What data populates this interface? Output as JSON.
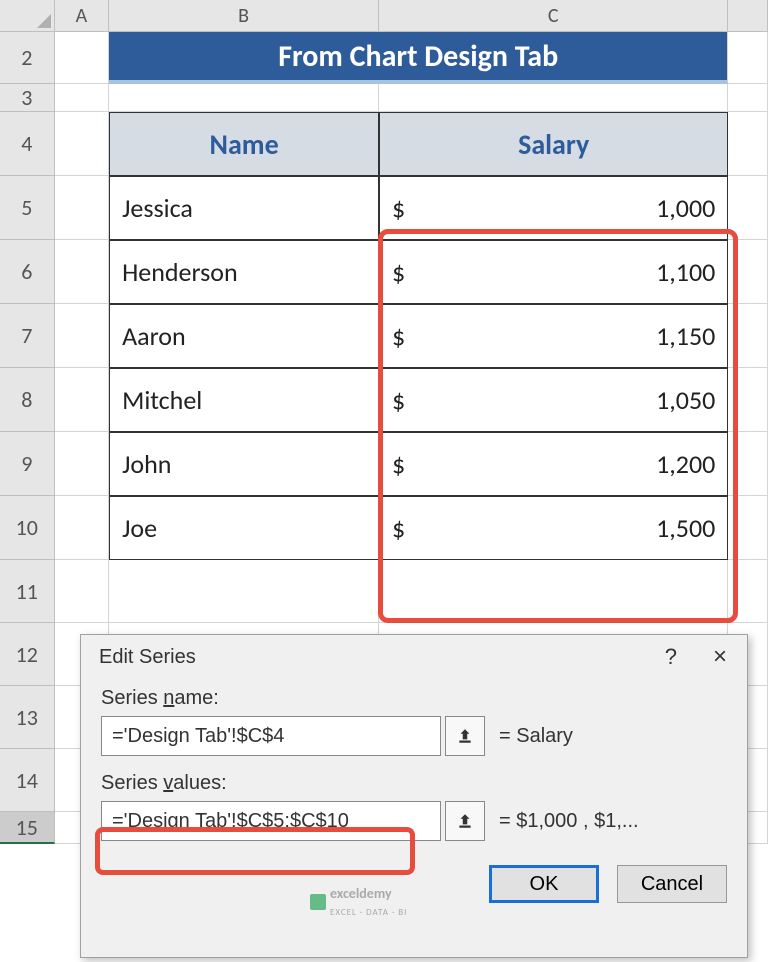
{
  "col_headers": {
    "A": "A",
    "B": "B",
    "C": "C"
  },
  "row_headers": [
    "2",
    "3",
    "4",
    "5",
    "6",
    "7",
    "8",
    "9",
    "10",
    "11",
    "12",
    "13",
    "14",
    "15"
  ],
  "title": "From Chart Design Tab",
  "table": {
    "head_name": "Name",
    "head_salary": "Salary",
    "rows": [
      {
        "name": "Jessica",
        "sym": "$",
        "val": "1,000"
      },
      {
        "name": "Henderson",
        "sym": "$",
        "val": "1,100"
      },
      {
        "name": "Aaron",
        "sym": "$",
        "val": "1,150"
      },
      {
        "name": "Mitchel",
        "sym": "$",
        "val": "1,050"
      },
      {
        "name": "John",
        "sym": "$",
        "val": "1,200"
      },
      {
        "name": "Joe",
        "sym": "$",
        "val": "1,500"
      }
    ]
  },
  "dialog": {
    "title": "Edit Series",
    "help": "?",
    "close": "×",
    "series_name_label_pre": "Series ",
    "series_name_label_ul": "n",
    "series_name_label_post": "ame:",
    "series_name_value": "='Design Tab'!$C$4",
    "series_name_eq": "= Salary",
    "series_values_label_pre": "Series ",
    "series_values_label_ul": "v",
    "series_values_label_post": "alues:",
    "series_values_value": "='Design Tab'!$C$5:$C$10",
    "series_values_eq": "= $1,000 , $1,...",
    "ok": "OK",
    "cancel": "Cancel"
  },
  "watermark": {
    "text": "exceldemy",
    "sub": "EXCEL · DATA · BI"
  }
}
